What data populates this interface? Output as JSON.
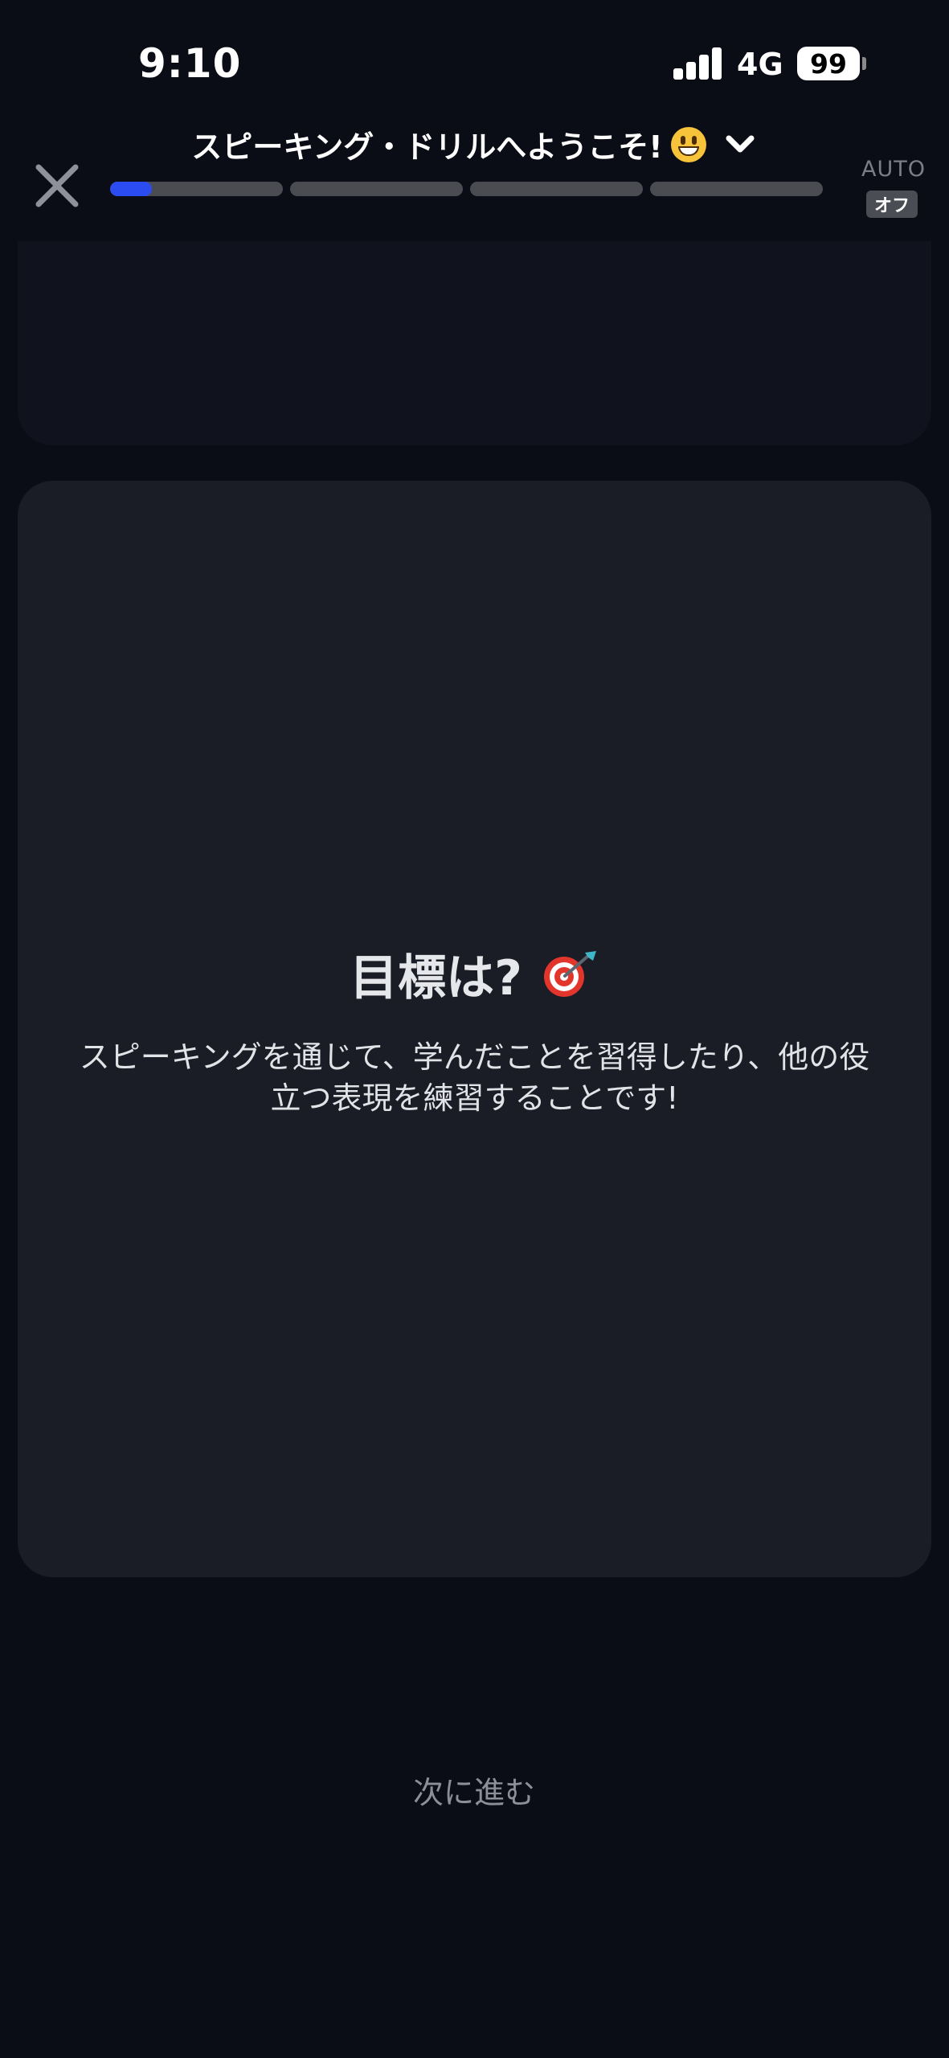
{
  "status_bar": {
    "time": "9:10",
    "network": "4G",
    "battery": "99"
  },
  "header": {
    "title": "スピーキング・ドリルへようこそ!",
    "title_emoji": "smiley-face-icon",
    "progress": {
      "segments": 4,
      "current_segment_fill": 0.24,
      "accent_color": "#2a4cf0"
    },
    "auto_label": "AUTO",
    "auto_toggle": "オフ"
  },
  "card": {
    "heading": "目標は?",
    "heading_icon": "dart-target-icon",
    "body": "スピーキングを通じて、学んだことを習得したり、他の役立つ表現を練習することです!"
  },
  "footer": {
    "next_label": "次に進む"
  }
}
